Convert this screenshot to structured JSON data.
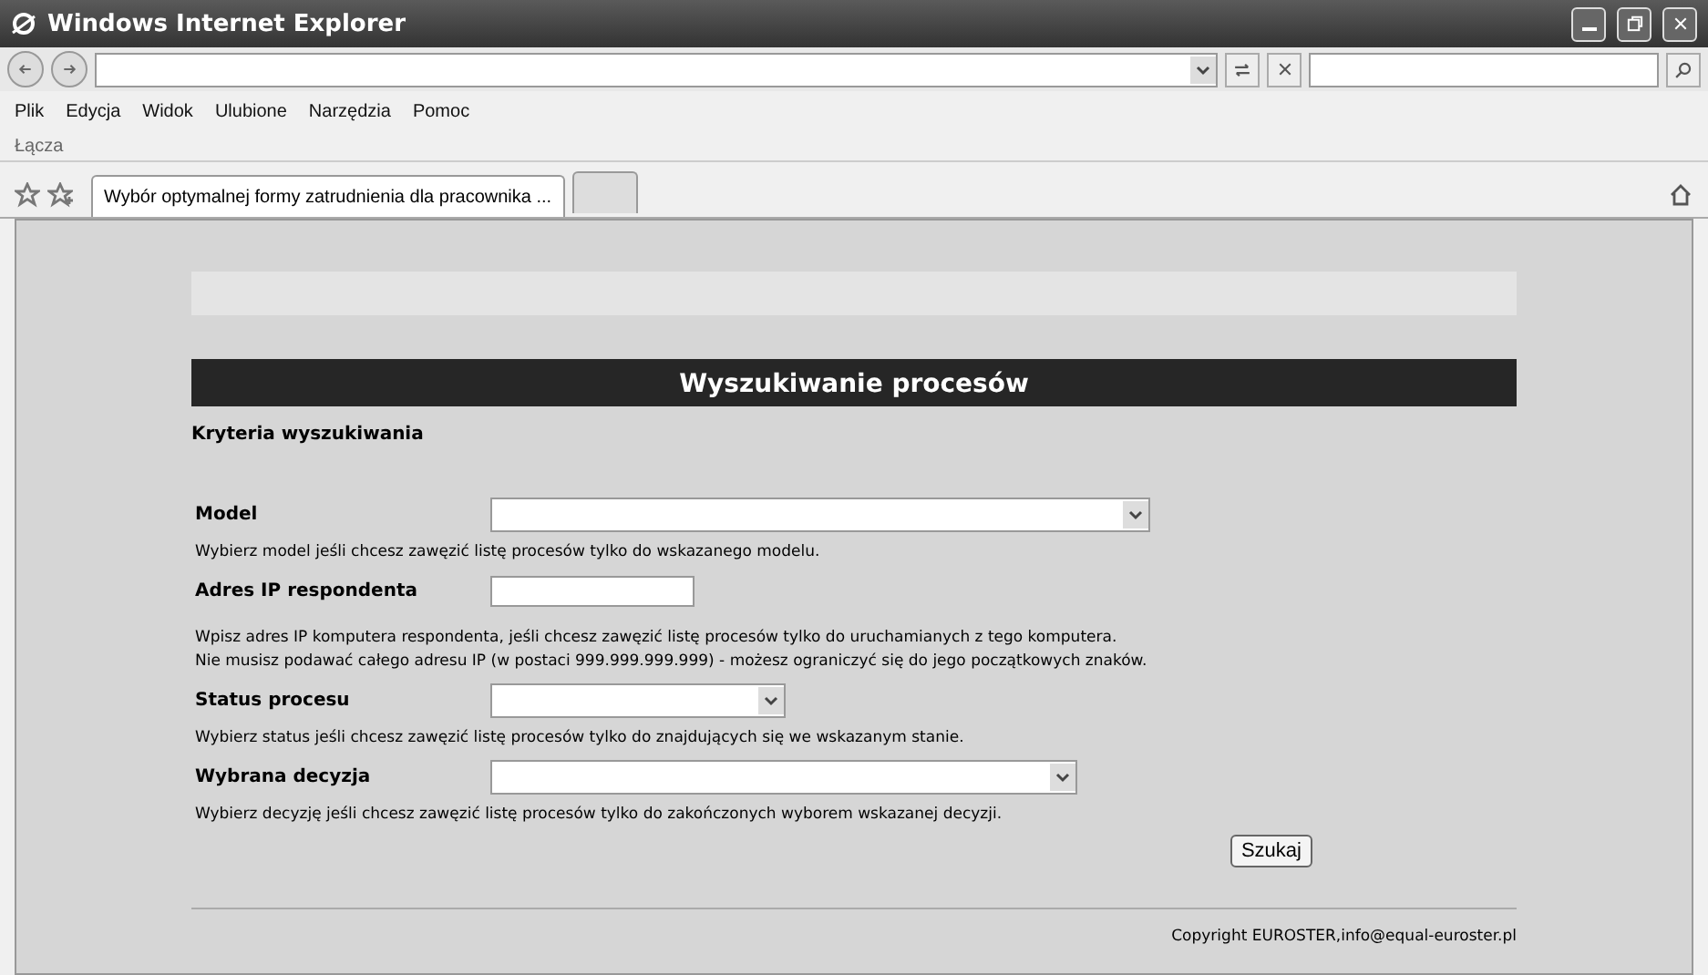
{
  "window": {
    "title": "Windows Internet Explorer"
  },
  "menu": [
    "Plik",
    "Edycja",
    "Widok",
    "Ulubione",
    "Narzędzia",
    "Pomoc"
  ],
  "links_bar": {
    "label": "Łącza"
  },
  "tabs": [
    {
      "label": "Wybór optymalnej formy zatrudnienia dla pracownika ...",
      "selected": true
    },
    {
      "selected": false
    }
  ],
  "page": {
    "heading": "Wyszukiwanie procesów",
    "subheading": "Kryteria wyszukiwania",
    "fields": [
      {
        "kind": "select",
        "label": "Model",
        "hint": [
          "Wybierz model jeśli chcesz zawęzić listę procesów tylko do wskazanego modelu."
        ]
      },
      {
        "kind": "text",
        "label": "Adres IP respondenta",
        "hint": [
          "Wpisz adres IP komputera respondenta, jeśli chcesz zawęzić listę procesów tylko do uruchamianych z tego komputera.",
          "Nie musisz podawać całego adresu IP (w postaci 999.999.999.999) - możesz ograniczyć się do jego początkowych znaków."
        ]
      },
      {
        "kind": "select",
        "label": "Status procesu",
        "hint": [
          "Wybierz status jeśli chcesz zawęzić listę procesów tylko do znajdujących się we wskazanym stanie."
        ]
      },
      {
        "kind": "select",
        "label": "Wybrana decyzja",
        "hint": [
          "Wybierz decyzję jeśli chcesz zawęzić listę procesów tylko do zakończonych wyborem wskazanej decyzji."
        ]
      }
    ],
    "search_button": "Szukaj",
    "footer": "Copyright EUROSTER,info@equal-euroster.pl"
  }
}
